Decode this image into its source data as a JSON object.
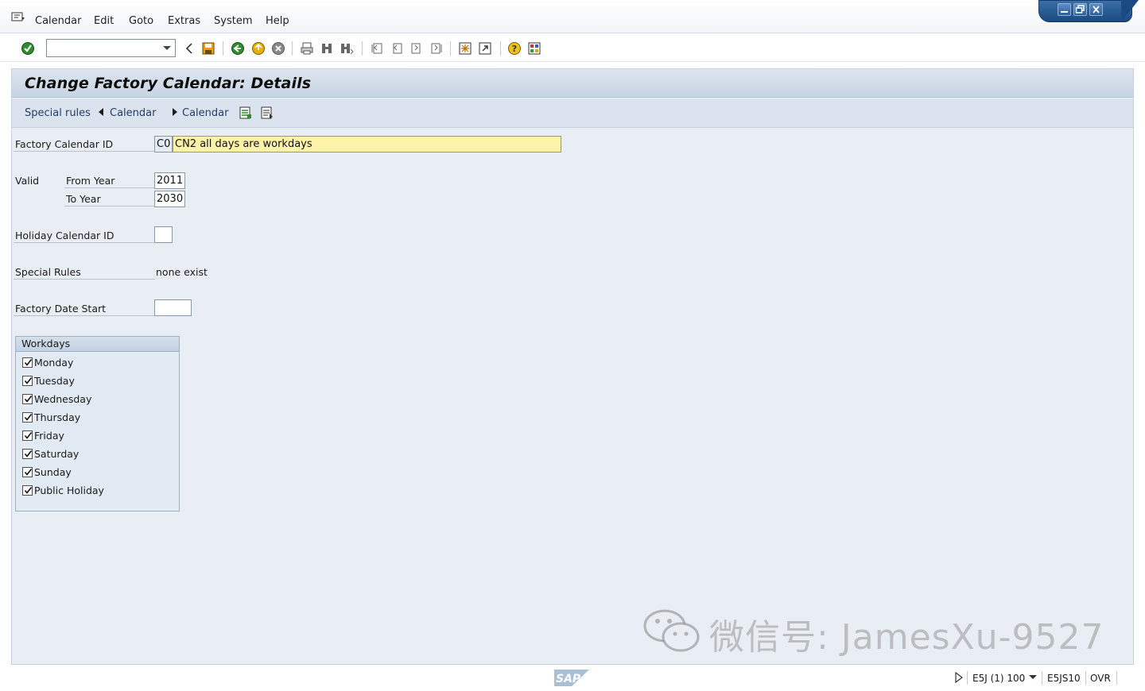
{
  "menubar": {
    "items": [
      "Calendar",
      "Edit",
      "Goto",
      "Extras",
      "System",
      "Help"
    ]
  },
  "window_controls": [
    "minimize",
    "restore",
    "close"
  ],
  "toolbar": {
    "command_field_value": ""
  },
  "title": "Change Factory Calendar: Details",
  "app_toolbar": {
    "special_rules": "Special rules",
    "prev_calendar": "Calendar",
    "next_calendar": "Calendar"
  },
  "form": {
    "factory_calendar_id_label": "Factory Calendar ID",
    "factory_calendar_id_value": "C0",
    "factory_calendar_desc": "CN2 all days are workdays",
    "valid_label": "Valid",
    "from_year_label": "From Year",
    "from_year_value": "2011",
    "to_year_label": "To Year",
    "to_year_value": "2030",
    "holiday_calendar_label": "Holiday Calendar ID",
    "holiday_calendar_value": "",
    "special_rules_label": "Special Rules",
    "special_rules_value": "none exist",
    "factory_date_start_label": "Factory Date Start",
    "factory_date_start_value": ""
  },
  "workdays": {
    "title": "Workdays",
    "items": [
      {
        "label": "Monday",
        "checked": true
      },
      {
        "label": "Tuesday",
        "checked": true
      },
      {
        "label": "Wednesday",
        "checked": true
      },
      {
        "label": "Thursday",
        "checked": true
      },
      {
        "label": "Friday",
        "checked": true
      },
      {
        "label": "Saturday",
        "checked": true
      },
      {
        "label": "Sunday",
        "checked": true
      },
      {
        "label": "Public Holiday",
        "checked": true
      }
    ]
  },
  "statusbar": {
    "logo_text": "SAP",
    "system": "E5J (1) 100",
    "server": "E5JS10",
    "mode": "OVR"
  },
  "watermark": "微信号: JamesXu-9527",
  "colors": {
    "title_bg": "#c7d4e2",
    "main_bg": "#e9eef5",
    "highlight_field": "#fdf2a6",
    "link_text": "#253d63"
  }
}
